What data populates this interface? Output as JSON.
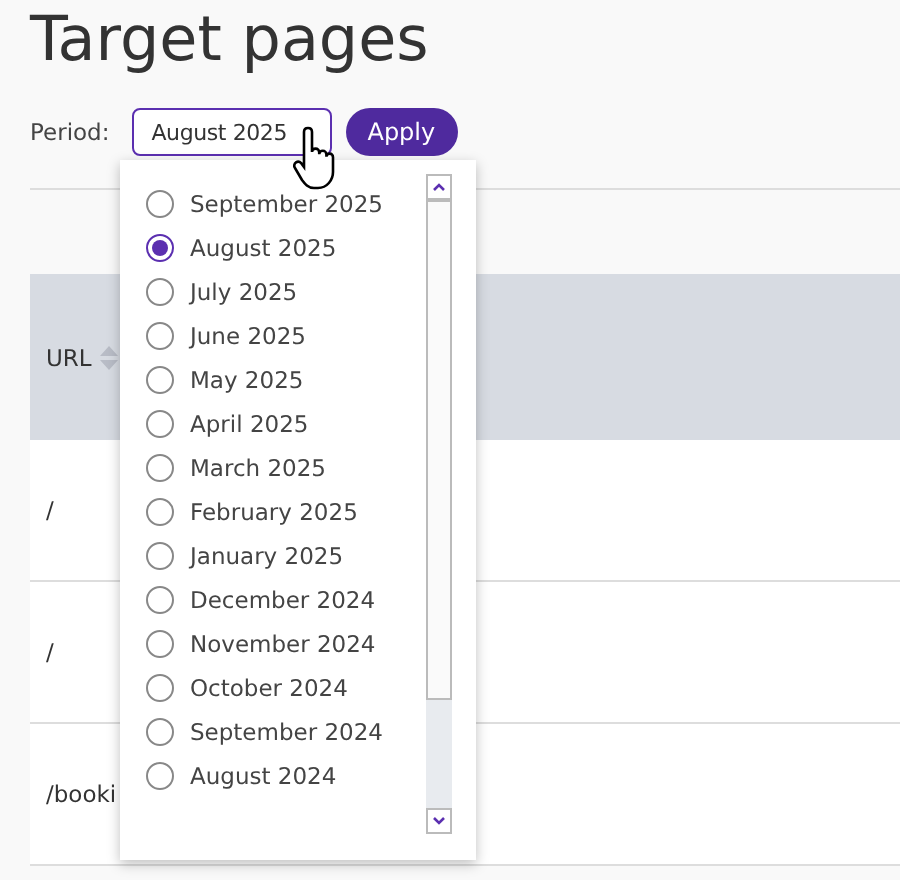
{
  "page": {
    "title": "Target pages"
  },
  "filter": {
    "label": "Period:",
    "value": "August 2025",
    "apply": "Apply"
  },
  "table": {
    "columns": [
      "URL"
    ],
    "rows": [
      [
        "/"
      ],
      [
        "/"
      ],
      [
        "/booki"
      ]
    ]
  },
  "dropdown": {
    "options": [
      {
        "label": "September 2025",
        "selected": false
      },
      {
        "label": "August 2025",
        "selected": true
      },
      {
        "label": "July 2025",
        "selected": false
      },
      {
        "label": "June 2025",
        "selected": false
      },
      {
        "label": "May 2025",
        "selected": false
      },
      {
        "label": "April 2025",
        "selected": false
      },
      {
        "label": "March 2025",
        "selected": false
      },
      {
        "label": "February 2025",
        "selected": false
      },
      {
        "label": "January 2025",
        "selected": false
      },
      {
        "label": "December 2024",
        "selected": false
      },
      {
        "label": "November 2024",
        "selected": false
      },
      {
        "label": "October 2024",
        "selected": false
      },
      {
        "label": "September 2024",
        "selected": false
      },
      {
        "label": "August 2024",
        "selected": false
      }
    ]
  }
}
